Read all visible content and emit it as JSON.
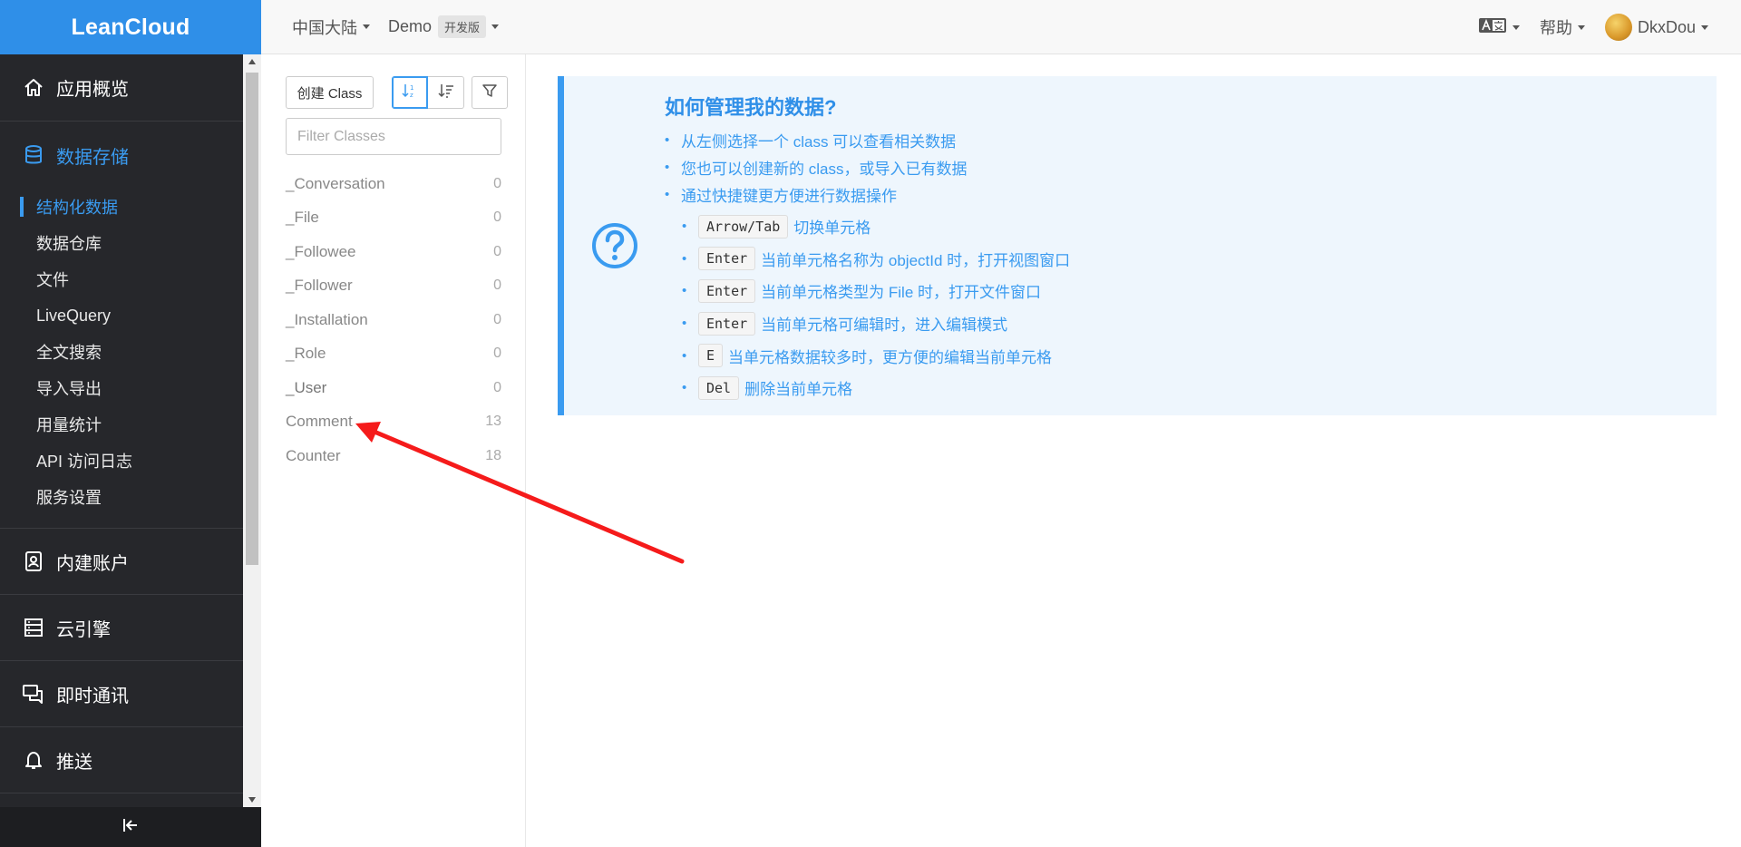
{
  "app": {
    "brand": "LeanCloud"
  },
  "sidebar": {
    "sections_top": [
      {
        "label": "应用概览",
        "icon": "home-icon"
      },
      {
        "label": "数据存储",
        "icon": "database-icon",
        "active": true
      }
    ],
    "sub_items": [
      {
        "label": "结构化数据",
        "active": true
      },
      {
        "label": "数据仓库"
      },
      {
        "label": "文件"
      },
      {
        "label": "LiveQuery"
      },
      {
        "label": "全文搜索"
      },
      {
        "label": "导入导出"
      },
      {
        "label": "用量统计"
      },
      {
        "label": "API 访问日志"
      },
      {
        "label": "服务设置"
      }
    ],
    "sections_bottom": [
      {
        "label": "内建账户",
        "icon": "user-card-icon"
      },
      {
        "label": "云引擎",
        "icon": "server-icon"
      },
      {
        "label": "即时通讯",
        "icon": "chat-icon"
      },
      {
        "label": "推送",
        "icon": "bell-icon"
      }
    ]
  },
  "topbar": {
    "region": "中国大陆",
    "app_name": "Demo",
    "plan_badge": "开发版",
    "help": "帮助",
    "user": "DkxDou"
  },
  "class_panel": {
    "create_label": "创建 Class",
    "filter_placeholder": "Filter Classes",
    "classes": [
      {
        "name": "_Conversation",
        "count": "0"
      },
      {
        "name": "_File",
        "count": "0"
      },
      {
        "name": "_Followee",
        "count": "0"
      },
      {
        "name": "_Follower",
        "count": "0"
      },
      {
        "name": "_Installation",
        "count": "0"
      },
      {
        "name": "_Role",
        "count": "0"
      },
      {
        "name": "_User",
        "count": "0"
      },
      {
        "name": "Comment",
        "count": "13"
      },
      {
        "name": "Counter",
        "count": "18"
      }
    ]
  },
  "help": {
    "title": "如何管理我的数据?",
    "tips": [
      "从左侧选择一个 class 可以查看相关数据",
      "您也可以创建新的 class，或导入已有数据",
      "通过快捷键更方便进行数据操作"
    ],
    "shortcuts": [
      {
        "key": "Arrow/Tab",
        "desc": "切换单元格"
      },
      {
        "key": "Enter",
        "desc": "当前单元格名称为 objectId 时，打开视图窗口"
      },
      {
        "key": "Enter",
        "desc": "当前单元格类型为 File 时，打开文件窗口"
      },
      {
        "key": "Enter",
        "desc": "当前单元格可编辑时，进入编辑模式"
      },
      {
        "key": "E",
        "desc": "当单元格数据较多时，更方便的编辑当前单元格"
      },
      {
        "key": "Del",
        "desc": "删除当前单元格"
      }
    ]
  },
  "colors": {
    "accent": "#3a9bf0",
    "brand": "#2f8fe8",
    "sidebar": "#26272b",
    "annotation": "#f51b1b"
  }
}
